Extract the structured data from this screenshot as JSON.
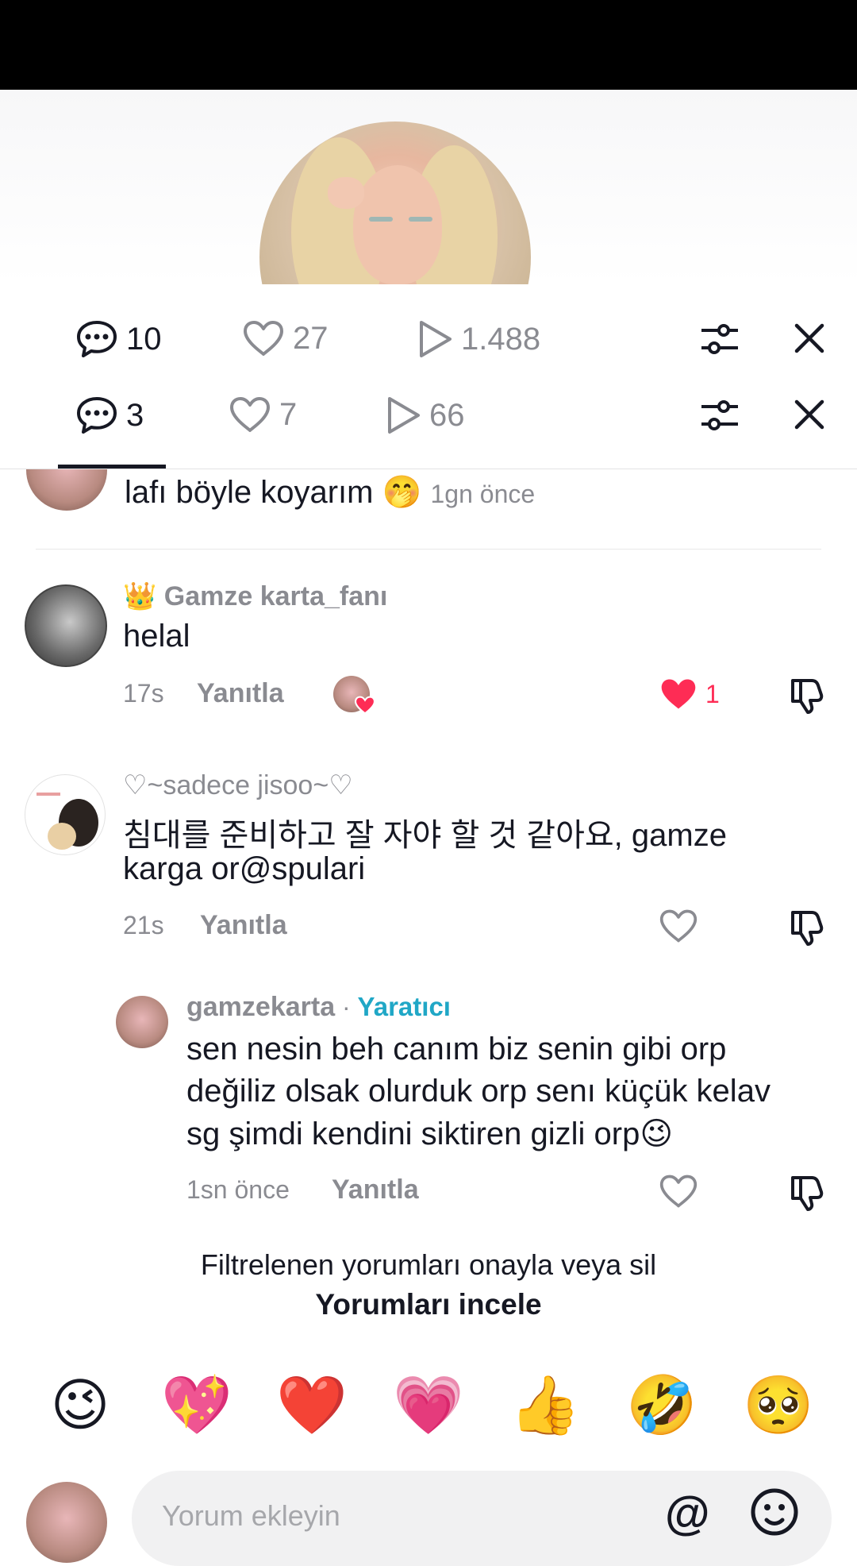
{
  "video_stats_main": {
    "comments": "10",
    "likes": "27",
    "views": "1.488"
  },
  "video_stats_tab": {
    "comments": "3",
    "likes": "7",
    "views": "66"
  },
  "comments": [
    {
      "body": "lafı böyle koyarım 🤭",
      "time": "1gn önce"
    },
    {
      "badge": "👑",
      "username": "Gamze karta_fanı",
      "body": "helal",
      "time": "17s",
      "reply": "Yanıtla",
      "likes": "1"
    },
    {
      "username": "♡~sadece jisoo~♡",
      "body_line1": "침대를 준비하고 잘 자야 할 것 같아요, gamze",
      "body_line2": "karga or@spulari",
      "time": "21s",
      "reply": "Yanıtla"
    },
    {
      "username": "gamzekarta",
      "separator": " · ",
      "role": "Yaratıcı",
      "body_line1": "sen nesin beh canım biz senin gibi orp",
      "body_line2": "değiliz olsak olurduk orp senı küçük kelav",
      "body_line3": "sg şimdi kendini siktiren gizli orp😉",
      "time": "1sn önce",
      "reply": "Yanıtla"
    }
  ],
  "filter": {
    "text": "Filtrelenen yorumları onayla veya sil",
    "action": "Yorumları incele"
  },
  "quick_emojis": [
    "😉",
    "💖",
    "❤️",
    "💗",
    "👍",
    "🤣",
    "🥺"
  ],
  "composer": {
    "placeholder": "Yorum ekleyin",
    "at_symbol": "@"
  },
  "colors": {
    "like_red": "#fe2c55",
    "creator_blue": "#20a7c6"
  }
}
